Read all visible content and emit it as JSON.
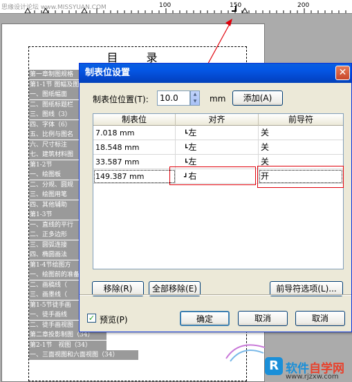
{
  "ruler": {
    "watermark": "思缘设计论坛 www.MISSYUAN.COM",
    "labels": [
      "100",
      "150",
      "200"
    ]
  },
  "document": {
    "title": "目 录",
    "toc_lines": [
      "第一章制图规格",
      "第1-1节 图幅及图框",
      "一、图纸幅面",
      "二、图纸标题栏",
      "三、图线（3）",
      "四、字体（6）",
      "五、比例与图名",
      "六、尺寸标注",
      "七、建筑材料图",
      "第1-2节",
      "一、绘图板",
      "二、分规、圆规",
      "三、绘图用笔",
      "四、其他辅助",
      "第1-3节",
      "一、直线的平行",
      "二、正多边形",
      "三、圆弧连接",
      "四、椭圆画法",
      "第1-4节绘图方",
      "一、绘图前的准备",
      "二、画稿线（",
      "三、画墨线（",
      "第1-5节徒手画",
      "一、徒手画线",
      "二、徒手画视图",
      "第二章投影制图（34）",
      "第2-1节　视图（34）",
      "一、三面视图和六面视图（34）"
    ]
  },
  "dialog": {
    "title": "制表位设置",
    "close_label": "✕",
    "position_label": "制表位位置(T):",
    "position_value": "10.0",
    "unit": "mm",
    "add_label": "添加(A)",
    "table": {
      "headers": [
        "制表位",
        "对齐",
        "前导符"
      ],
      "rows": [
        {
          "pos": "7.018 mm",
          "align": "左",
          "leader": "关"
        },
        {
          "pos": "18.548 mm",
          "align": "左",
          "leader": "关"
        },
        {
          "pos": "33.587 mm",
          "align": "左",
          "leader": "关"
        },
        {
          "pos": "149.387 mm",
          "align": "右",
          "leader": "开"
        }
      ]
    },
    "remove_label": "移除(R)",
    "remove_all_label": "全部移除(E)",
    "leader_options_label": "前导符选项(L)...",
    "preview_label": "预览(P)",
    "ok_label": "确定",
    "cancel_label": "取消",
    "help_label": "取消"
  },
  "watermark": {
    "logo": "R",
    "name_a": "软件",
    "name_b": "自学网",
    "url": "www.rjzxw.com"
  },
  "colors": {
    "highlight": "#e0000a",
    "titlebar": "#0458e6",
    "dialog_bg": "#ece9d8",
    "toc_selection": "#9a9a9a"
  }
}
